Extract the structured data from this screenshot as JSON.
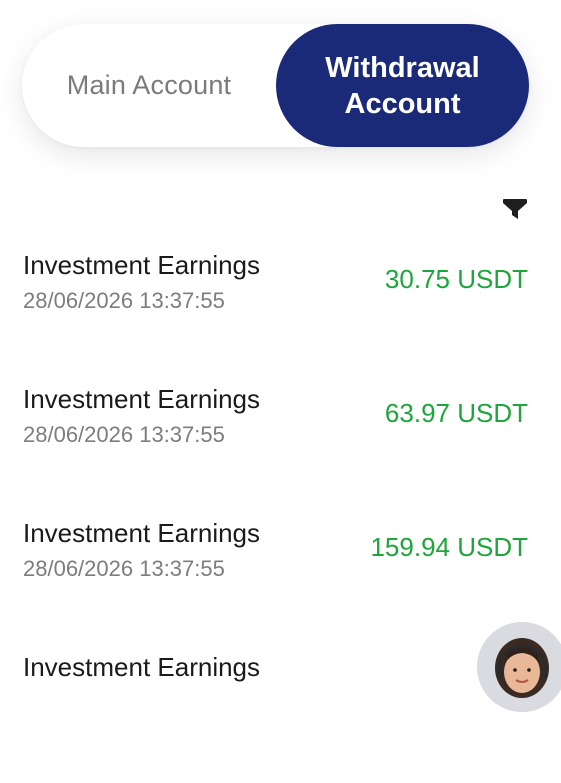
{
  "tabs": {
    "main_label": "Main Account",
    "withdrawal_label": "Withdrawal Account",
    "active": "withdrawal"
  },
  "filter": {
    "icon": "filter-icon"
  },
  "transactions": [
    {
      "title": "Investment Earnings",
      "time": "28/06/2026 13:37:55",
      "amount": "30.75 USDT"
    },
    {
      "title": "Investment Earnings",
      "time": "28/06/2026 13:37:55",
      "amount": "63.97 USDT"
    },
    {
      "title": "Investment Earnings",
      "time": "28/06/2026 13:37:55",
      "amount": "159.94 USDT"
    },
    {
      "title": "Investment Earnings",
      "time": "",
      "amount": ""
    }
  ],
  "support": {
    "icon": "support-agent-avatar"
  },
  "colors": {
    "accent": "#1b2a78",
    "amount_positive": "#1ea63c",
    "muted_text": "#7d7d7d"
  }
}
